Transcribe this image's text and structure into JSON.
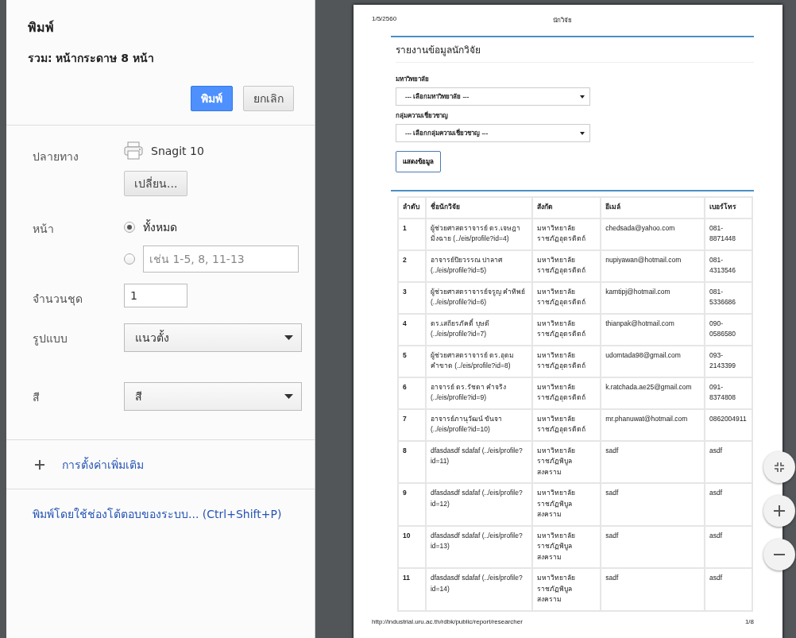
{
  "dialog": {
    "title": "พิมพ์",
    "summary": "รวม: หน้ากระดาษ 8 หน้า",
    "print_button": "พิมพ์",
    "cancel_button": "ยกเลิก",
    "settings": [
      {
        "kind": "destination",
        "label": "ปลายทาง",
        "printer": "Snagit 10",
        "button": "เปลี่ยน..."
      },
      {
        "kind": "pages",
        "label": "หน้า",
        "options": [
          {
            "label": "ทั้งหมด",
            "selected": true
          },
          {
            "placeholder": "เช่น 1-5, 8, 11-13",
            "selected": false
          }
        ]
      },
      {
        "kind": "number",
        "label": "จำนวนชุด",
        "value": "1"
      },
      {
        "kind": "select",
        "label": "รูปแบบ",
        "value": "แนวตั้ง"
      },
      {
        "kind": "select",
        "label": "สี",
        "value": "สี"
      }
    ],
    "more_settings": "การตั้งค่าเพิ่มเติม",
    "system_dialog_link": "พิมพ์โดยใช้ช่องโต้ตอบของระบบ... (Ctrl+Shift+P)"
  },
  "preview": {
    "header_date": "1/5/2560",
    "header_title": "นักวิจัย",
    "report_title": "รายงานข้อมูลนักวิจัย",
    "filters": [
      {
        "label": "มหาวิทยาลัย",
        "value": "--- เลือกมหาวิทยาลัย ---"
      },
      {
        "label": "กลุ่มความเชี่ยวชาญ",
        "value": "--- เลือกกลุ่มความเชี่ยวชาญ ---"
      }
    ],
    "show_button": "แสดงข้อมูล",
    "table": {
      "columns": [
        "ลำดับ",
        "ชื่อนักวิจัย",
        "สังกัด",
        "อีเมล์",
        "เบอร์โทร"
      ],
      "rows": [
        [
          "1",
          "ผู้ช่วยศาสตราจารย์ ดร.เจษฎา มิ่งฉาย (../eis/profile?id=4)",
          "มหาวิทยาลัยราชภัฏอุตรดิตถ์",
          "chedsada@yahoo.com",
          "081-8871448"
        ],
        [
          "2",
          "อาจารย์ปิยวรรณ ปาลาศ (../eis/profile?id=5)",
          "มหาวิทยาลัยราชภัฏอุตรดิตถ์",
          "nupiyawan@hotmail.com",
          "081-4313546"
        ],
        [
          "3",
          "ผู้ช่วยศาสตราจารย์จรูญ คำทิพย์ (../eis/profile?id=6)",
          "มหาวิทยาลัยราชภัฏอุตรดิตถ์",
          "kamtipj@hotmail.com",
          "081-5336686"
        ],
        [
          "4",
          "ดร.เสถียรภัคดิ์ บุษดี (../eis/profile?id=7)",
          "มหาวิทยาลัยราชภัฏอุตรดิตถ์",
          "thianpak@hotmail.com",
          "090-0586580"
        ],
        [
          "5",
          "ผู้ช่วยศาสตราจารย์ ดร.อุดม คำขาด (../eis/profile?id=8)",
          "มหาวิทยาลัยราชภัฏอุตรดิตถ์",
          "udomtada98@gmail.com",
          "093-2143399"
        ],
        [
          "6",
          "อาจารย์ ดร.รัชดา คำจริง (../eis/profile?id=9)",
          "มหาวิทยาลัยราชภัฏอุตรดิตถ์",
          "k.ratchada.ae25@gmail.com",
          "091-8374808"
        ],
        [
          "7",
          "อาจารย์ภานุวัฒน์ ขันจา (../eis/profile?id=10)",
          "มหาวิทยาลัยราชภัฏอุตรดิตถ์",
          "mr.phanuwat@hotmail.com",
          "0862004911"
        ],
        [
          "8",
          "dfasdasdf sdafaf (../eis/profile?id=11)",
          "มหาวิทยาลัยราชภัฏพิบูลสงคราม",
          "sadf",
          "asdf"
        ],
        [
          "9",
          "dfasdasdf sdafaf (../eis/profile?id=12)",
          "มหาวิทยาลัยราชภัฏพิบูลสงคราม",
          "sadf",
          "asdf"
        ],
        [
          "10",
          "dfasdasdf sdafaf (../eis/profile?id=13)",
          "มหาวิทยาลัยราชภัฏพิบูลสงคราม",
          "sadf",
          "asdf"
        ],
        [
          "11",
          "dfasdasdf sdafaf (../eis/profile?id=14)",
          "มหาวิทยาลัยราชภัฏพิบูลสงคราม",
          "sadf",
          "asdf"
        ]
      ]
    },
    "footer_url": "http://industrial.uru.ac.th/rdbk/public/report/researcher",
    "footer_page": "1/8"
  }
}
